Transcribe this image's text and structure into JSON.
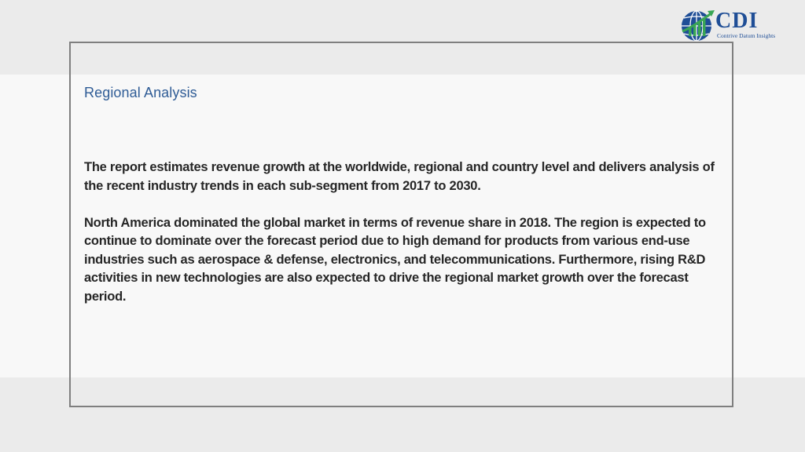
{
  "slide": {
    "heading": "Regional Analysis",
    "paragraphs": [
      "The report estimates revenue growth at the worldwide, regional and country level and delivers analysis of the recent industry trends in each sub-segment from 2017 to 2030.",
      "North America dominated the global market in terms of revenue share in 2018. The region is expected to continue to dominate over the forecast period due to high demand for products from various end-use industries such as aerospace & defense, electronics, and telecommunications. Furthermore, rising R&D activities in new technologies are also expected to drive the regional market growth over the forecast period."
    ]
  },
  "logo": {
    "letters": "CDI",
    "tagline": "Contrive Datum Insights",
    "icon": "globe-chart-icon"
  },
  "colors": {
    "heading": "#2f5c96",
    "body_text": "#262626",
    "frame": "#7f7f7f",
    "logo_blue": "#1f4e96",
    "logo_green": "#3aa655"
  }
}
